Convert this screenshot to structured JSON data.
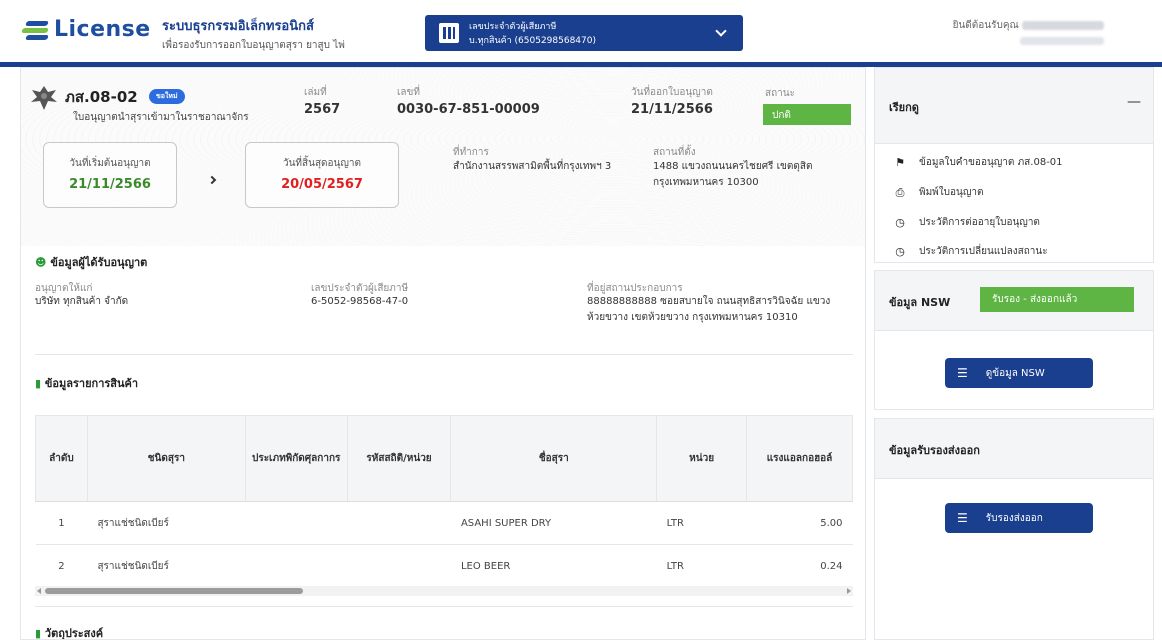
{
  "header": {
    "logo_text": "License",
    "system_title": "ระบบธุรกรรมอิเล็กทรอนิกส์",
    "system_subtitle": "เพื่อรองรับการออกใบอนุญาตสุรา ยาสูบ ไพ่",
    "tax_selector_label": "เลขประจำตัวผู้เสียภาษี",
    "tax_selector_value": "บ.ทุกสินค้า (6505298568470)",
    "welcome_text": "ยินดีต้อนรับคุณ"
  },
  "license": {
    "code": "ภส.08-02",
    "badge": "ขอใหม่",
    "name": "ใบอนุญาตนำสุราเข้ามาในราชอาณาจักร",
    "volume_label": "เล่มที่",
    "volume_value": "2567",
    "number_label": "เลขที่",
    "number_value": "0030-67-851-00009",
    "issue_date_label": "วันที่ออกใบอนุญาต",
    "issue_date_value": "21/11/2566",
    "status_label": "สถานะ",
    "status_value": "ปกติ",
    "start_date_label": "วันที่เริ่มต้นอนุญาต",
    "start_date_value": "21/11/2566",
    "end_date_label": "วันที่สิ้นสุดอนุญาต",
    "end_date_value": "20/05/2567",
    "office_label": "ที่ทำการ",
    "office_value": "สำนักงานสรรพสามิตพื้นที่กรุงเทพฯ 3",
    "location_label": "สถานที่ตั้ง",
    "location_line1": "1488 แขวงถนนนครไชยศรี เขตดุสิต",
    "location_line2": "กรุงเทพมหานคร 10300"
  },
  "licensee": {
    "section_title": "ข้อมูลผู้ได้รับอนุญาต",
    "grantee_label": "อนุญาตให้แก่",
    "grantee_value": "บริษัท ทุกสินค้า จำกัด",
    "tax_id_label": "เลขประจำตัวผู้เสียภาษี",
    "tax_id_value": "6-5052-98568-47-0",
    "address_label": "ที่อยู่สถานประกอบการ",
    "address_line1": "88888888888 ซอยสบายใจ ถนนสุทธิสารวินิจฉัย แขวง",
    "address_line2": "ห้วยขวาง เขตห้วยขวาง กรุงเทพมหานคร 10310"
  },
  "products": {
    "section_title": "ข้อมูลรายการสินค้า",
    "columns": [
      "ลำดับ",
      "ชนิดสุรา",
      "ประเภทพิกัดศุลกากร",
      "รหัสสถิติ/หน่วย",
      "ชื่อสุรา",
      "หน่วย",
      "แรงแอลกอฮอล์"
    ],
    "rows": [
      [
        "1",
        "สุราแช่ชนิดเบียร์",
        "",
        "",
        "ASAHI SUPER DRY",
        "LTR",
        "5.00"
      ],
      [
        "2",
        "สุราแช่ชนิดเบียร์",
        "",
        "",
        "LEO BEER",
        "LTR",
        "0.24"
      ]
    ]
  },
  "purpose": {
    "section_title": "วัตถุประสงค์"
  },
  "sidebar": {
    "index_title": "เรียกดู",
    "collapse_symbol": "—",
    "menu": [
      {
        "label": "ข้อมูลใบคำขออนุญาต ภส.08-01",
        "icon": "flag-icon"
      },
      {
        "label": "พิมพ์ใบอนุญาต",
        "icon": "print-icon"
      },
      {
        "label": "ประวัติการต่ออายุใบอนุญาต",
        "icon": "clock-icon"
      },
      {
        "label": "ประวัติการเปลี่ยนแปลงสถานะ",
        "icon": "clock-icon"
      }
    ],
    "nsw_title": "ข้อมูล NSW",
    "nsw_status": "รับรอง - ส่งออกแล้ว",
    "nsw_button": "ดูข้อมูล NSW",
    "export_title": "ข้อมูลรับรองส่งออก",
    "export_button": "รับรองส่งออก"
  },
  "colors": {
    "brand_blue": "#1a3f8f",
    "status_green": "#5fb544",
    "end_date_red": "#e02020",
    "start_date_green": "#3a8a2c"
  }
}
